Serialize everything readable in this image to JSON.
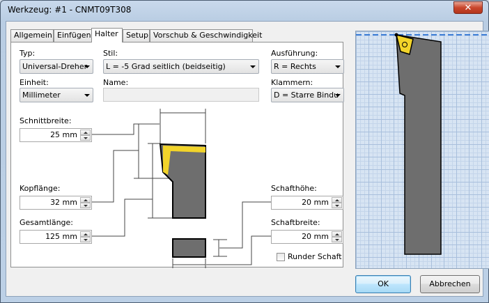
{
  "window": {
    "title": "Werkzeug: #1 - CNMT09T308",
    "close_glyph": "✕"
  },
  "tabs": [
    {
      "label": "Allgemein"
    },
    {
      "label": "Einfügen"
    },
    {
      "label": "Halter"
    },
    {
      "label": "Setup"
    },
    {
      "label": "Vorschub & Geschwindigkeit"
    }
  ],
  "active_tab": "Halter",
  "form": {
    "typ": {
      "label": "Typ:",
      "value": "Universal-Dreher"
    },
    "stil": {
      "label": "Stil:",
      "value": "L = -5 Grad seitlich (beidseitig)"
    },
    "ausfuehrung": {
      "label": "Ausführung:",
      "value": "R = Rechts"
    },
    "einheit": {
      "label": "Einheit:",
      "value": "Millimeter"
    },
    "name": {
      "label": "Name:",
      "value": ""
    },
    "klammern": {
      "label": "Klammern:",
      "value": "D = Starre Bindu"
    },
    "schnittbreite": {
      "label": "Schnittbreite:",
      "value": "25 mm"
    },
    "kopflaenge": {
      "label": "Kopflänge:",
      "value": "32 mm"
    },
    "gesamtlaenge": {
      "label": "Gesamtlänge:",
      "value": "125 mm"
    },
    "schafthoehe": {
      "label": "Schafthöhe:",
      "value": "20 mm"
    },
    "schaftbreite": {
      "label": "Schaftbreite:",
      "value": "20 mm"
    },
    "runder_schaft": {
      "label": "Runder Schaft",
      "checked": false
    }
  },
  "buttons": {
    "ok": "OK",
    "cancel": "Abbrechen"
  },
  "colors": {
    "insert": "#f2d42a",
    "holder": "#6e6e6e",
    "guide_line": "#3a7bd5",
    "grid_bg": "#d7e4f3"
  }
}
